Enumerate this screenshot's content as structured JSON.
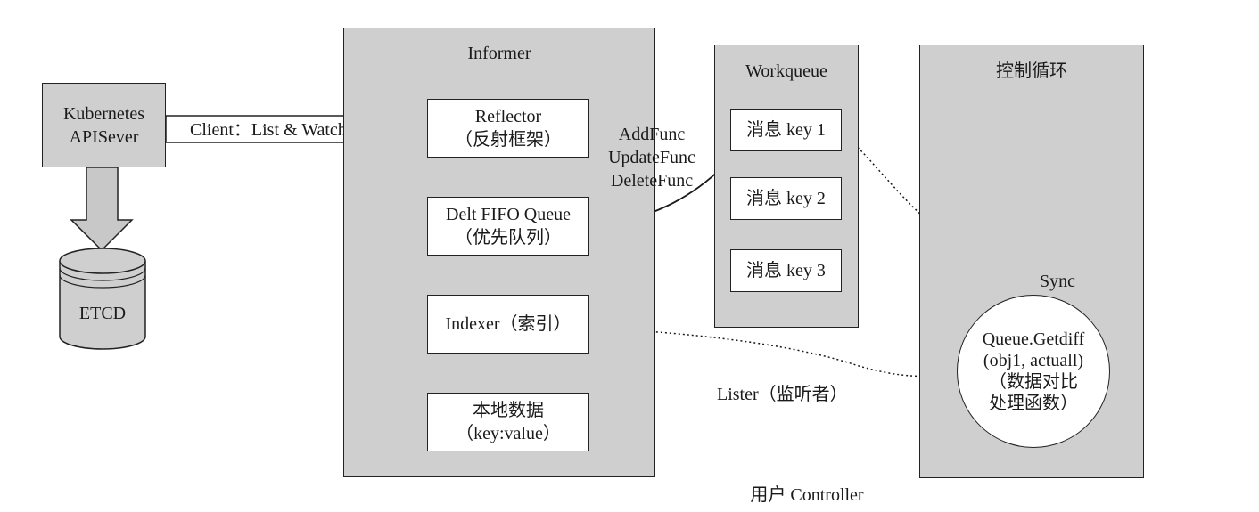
{
  "api_server": {
    "line1": "Kubernetes",
    "line2": "APISever"
  },
  "etcd": {
    "label": "ETCD"
  },
  "client_arrow": {
    "label": "Client：List & Watch"
  },
  "informer": {
    "title": "Informer",
    "reflector": {
      "line1": "Reflector",
      "line2": "（反射框架）"
    },
    "delta_fifo": {
      "line1": "Delt FIFO Queue",
      "line2": "（优先队列）"
    },
    "indexer": {
      "label": "Indexer（索引）"
    },
    "local_data": {
      "line1": "本地数据",
      "line2": "（key:value）"
    }
  },
  "handler_funcs": {
    "add": "AddFunc",
    "update": "UpdateFunc",
    "delete": "DeleteFunc"
  },
  "workqueue": {
    "title": "Workqueue",
    "items": [
      "消息 key 1",
      "消息 key 2",
      "消息 key 3"
    ]
  },
  "control_loop": {
    "title": "控制循环",
    "sync_label": "Sync",
    "circle": {
      "line1": "Queue.Getdiff",
      "line2": "(obj1, actuall)",
      "line3": "（数据对比",
      "line4": "处理函数）"
    }
  },
  "lister": {
    "label": "Lister（监听者）"
  },
  "caption": {
    "label": "用户 Controller"
  },
  "colors": {
    "panel_fill": "#cfcfcf",
    "stroke": "#222222",
    "box_fill": "#ffffff"
  }
}
